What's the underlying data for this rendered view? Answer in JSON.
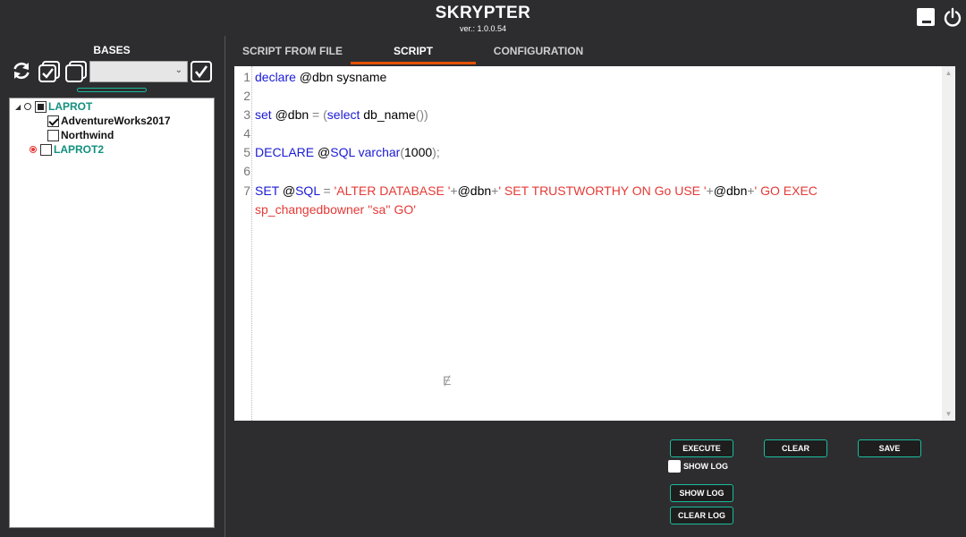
{
  "app": {
    "title": "SKRYPTER",
    "version": "ver.: 1.0.0.54"
  },
  "left_panel": {
    "title": "BASES",
    "server_select_value": "",
    "tree": [
      {
        "label": "LAPROT",
        "kind": "server",
        "state": "partial",
        "expanded": true,
        "radio": "empty"
      },
      {
        "label": "AdventureWorks2017",
        "kind": "database",
        "state": "checked"
      },
      {
        "label": "Northwind",
        "kind": "database",
        "state": "unchecked"
      },
      {
        "label": "LAPROT2",
        "kind": "server",
        "state": "unchecked",
        "radio": "active"
      }
    ]
  },
  "tabs": [
    {
      "label": "SCRIPT FROM FILE",
      "active": false
    },
    {
      "label": "SCRIPT",
      "active": true
    },
    {
      "label": "CONFIGURATION",
      "active": false
    }
  ],
  "editor": {
    "line_numbers": [
      "1",
      "2",
      "3",
      "4",
      "5",
      "6",
      "7"
    ],
    "lines": [
      [
        {
          "t": "declare",
          "c": "kw"
        },
        {
          "t": " @dbn sysname",
          "c": ""
        }
      ],
      [],
      [
        {
          "t": "set",
          "c": "kw"
        },
        {
          "t": " @dbn ",
          "c": ""
        },
        {
          "t": "=",
          "c": "op"
        },
        {
          "t": " ",
          "c": ""
        },
        {
          "t": "(",
          "c": "op"
        },
        {
          "t": "select",
          "c": "kw"
        },
        {
          "t": " db_name",
          "c": ""
        },
        {
          "t": "())",
          "c": "op"
        }
      ],
      [],
      [
        {
          "t": "DECLARE",
          "c": "kw"
        },
        {
          "t": " @",
          "c": ""
        },
        {
          "t": "SQL",
          "c": "kw"
        },
        {
          "t": " ",
          "c": ""
        },
        {
          "t": "varchar",
          "c": "kw"
        },
        {
          "t": "(",
          "c": "op"
        },
        {
          "t": "1000",
          "c": ""
        },
        {
          "t": ");",
          "c": "op"
        }
      ],
      [],
      [
        {
          "t": "SET",
          "c": "kw"
        },
        {
          "t": " @",
          "c": ""
        },
        {
          "t": "SQL",
          "c": "kw"
        },
        {
          "t": " ",
          "c": ""
        },
        {
          "t": "=",
          "c": "op"
        },
        {
          "t": " ",
          "c": ""
        },
        {
          "t": "'ALTER DATABASE '",
          "c": "str"
        },
        {
          "t": "+",
          "c": "op"
        },
        {
          "t": "@dbn",
          "c": ""
        },
        {
          "t": "+",
          "c": "op"
        },
        {
          "t": "' SET TRUSTWORTHY ON Go USE '",
          "c": "str"
        },
        {
          "t": "+",
          "c": "op"
        },
        {
          "t": "@dbn",
          "c": ""
        },
        {
          "t": "+",
          "c": "op"
        },
        {
          "t": "' GO EXEC",
          "c": "str"
        }
      ],
      [
        {
          "t": "sp_changedbowner ''sa'' GO'",
          "c": "str"
        }
      ]
    ]
  },
  "buttons": {
    "execute": "EXECUTE",
    "clear": "CLEAR",
    "save": "SAVE",
    "show_log_check": "SHOW LOG",
    "show_log": "SHOW LOG",
    "clear_log": "CLEAR LOG"
  },
  "colors": {
    "background": "#2d2d30",
    "accent": "#1abc9c",
    "tab_underline": "#e65100",
    "server_label": "#12907f",
    "keyword": "#1a1ad6",
    "string": "#e53935"
  }
}
